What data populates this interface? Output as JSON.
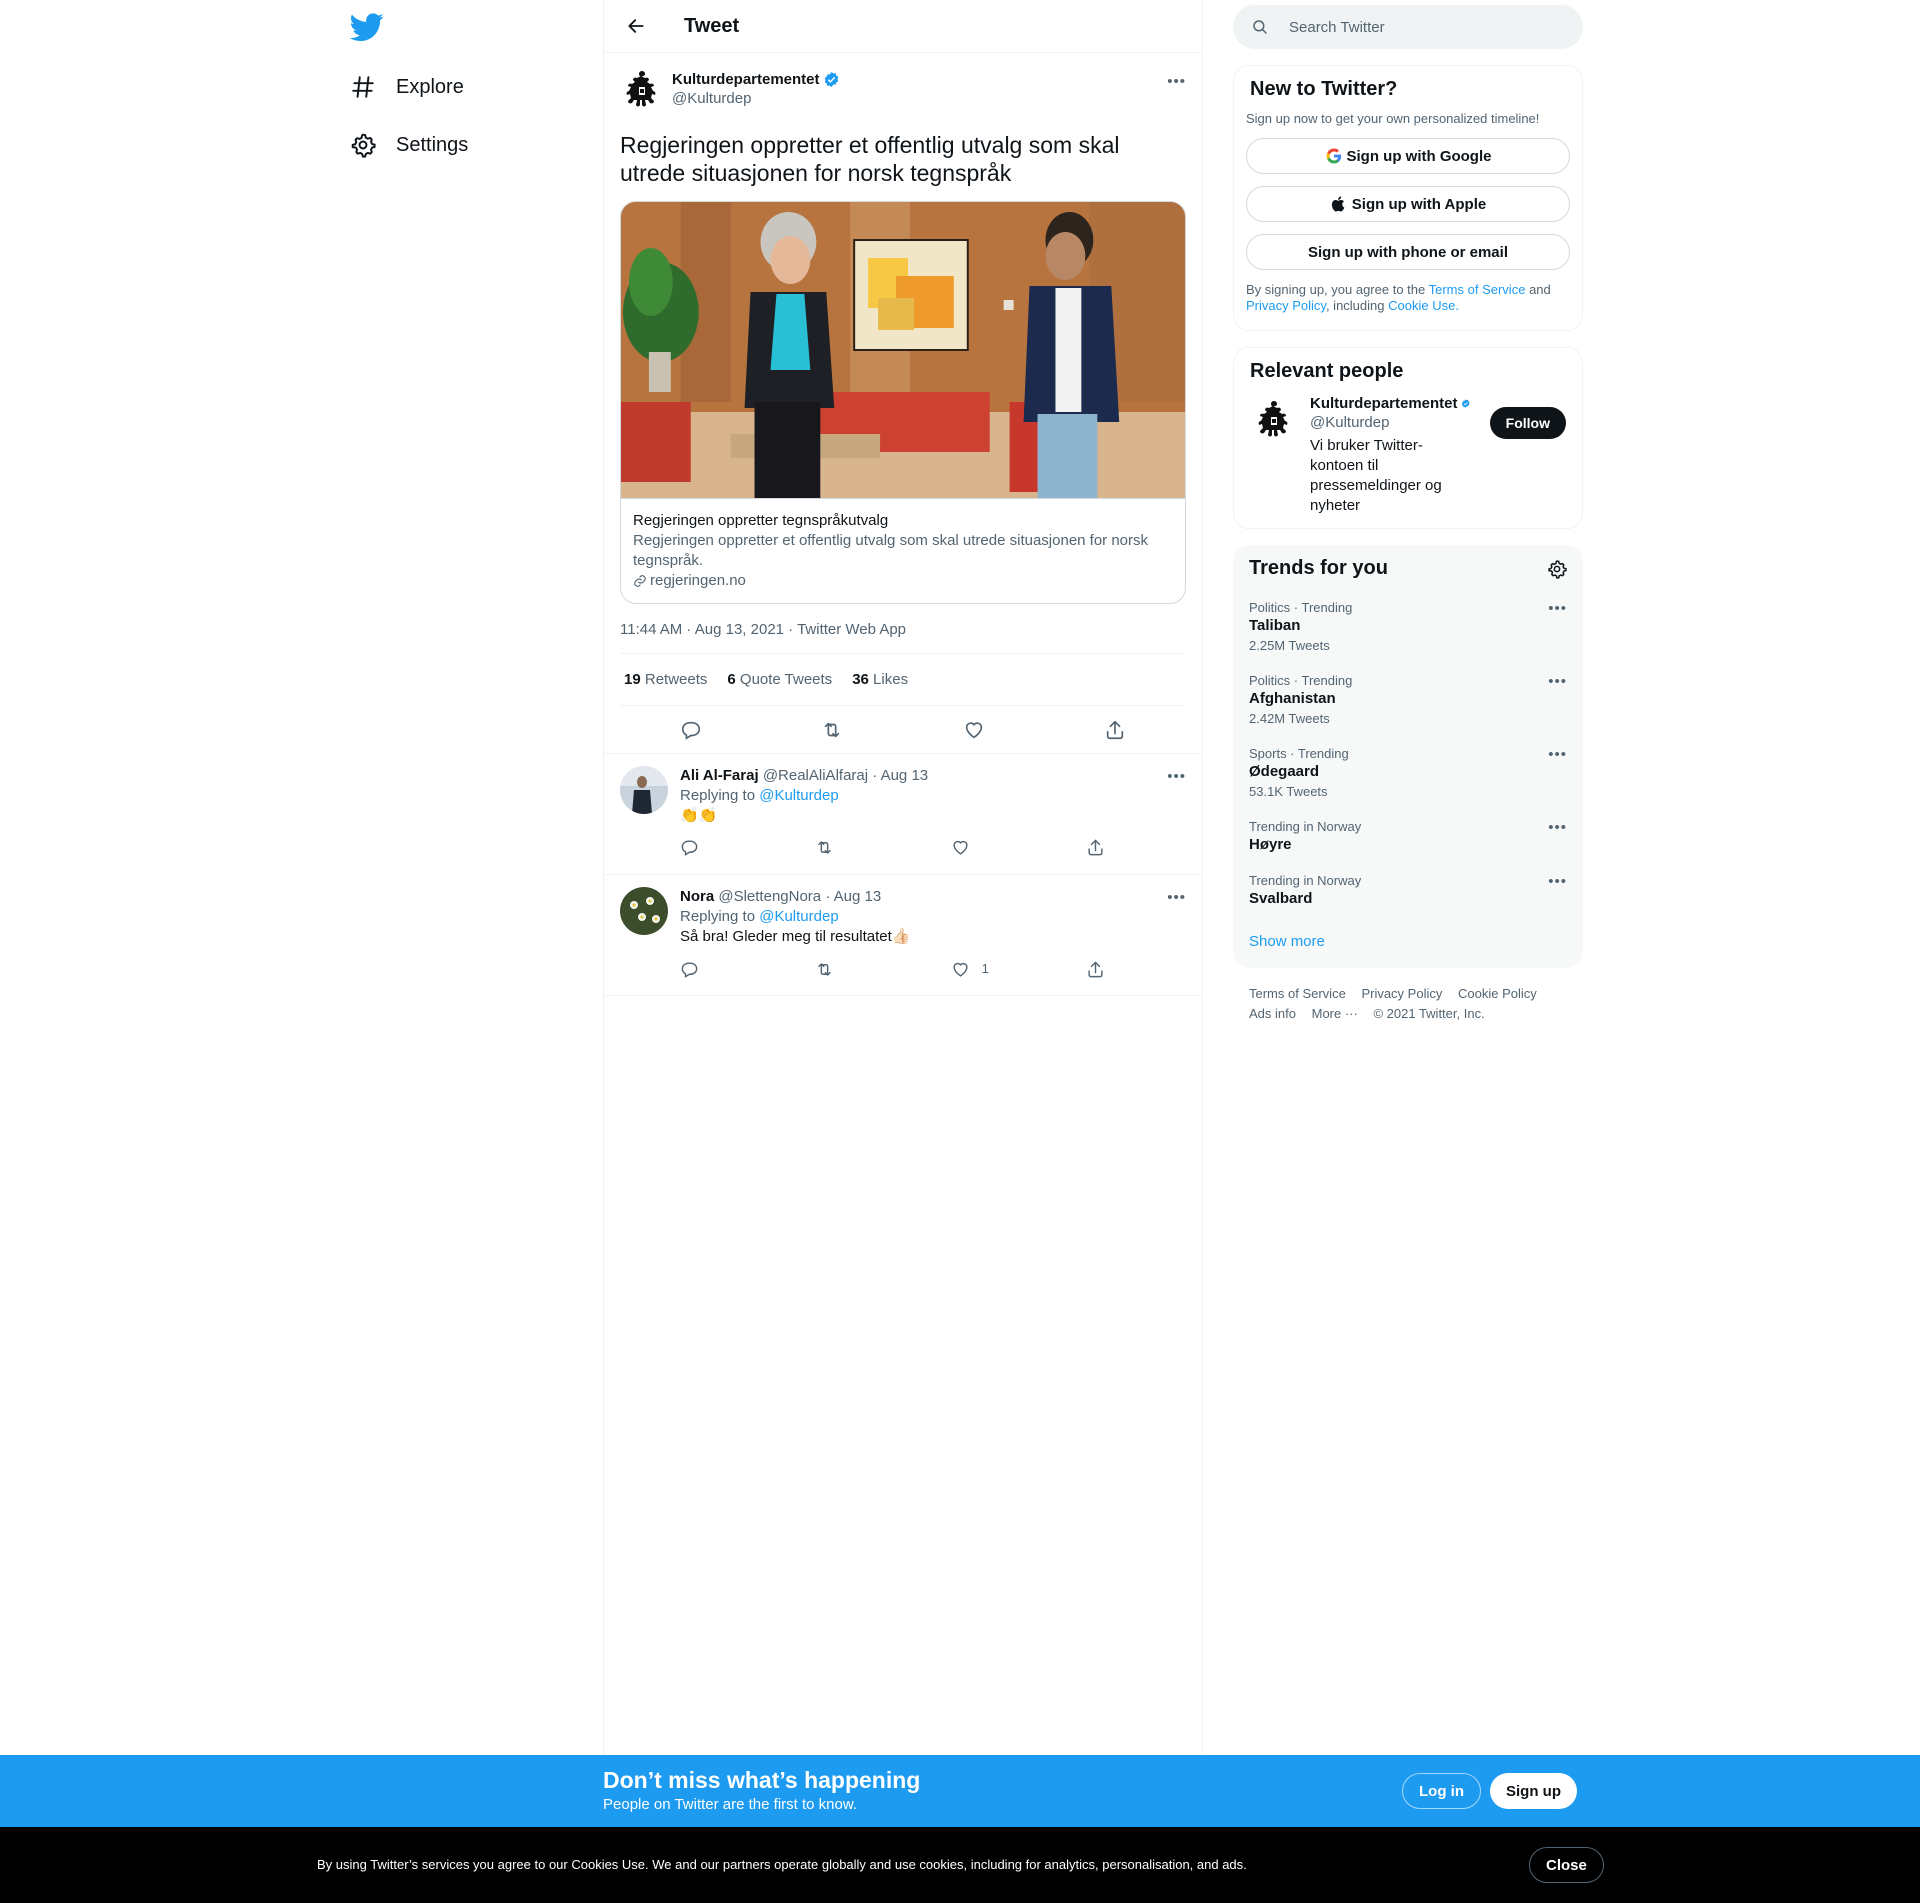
{
  "nav": {
    "logo_icon": "twitter-bird-icon",
    "items": [
      {
        "label": "Explore",
        "icon": "hashtag-icon"
      },
      {
        "label": "Settings",
        "icon": "gear-icon"
      }
    ]
  },
  "header": {
    "title": "Tweet"
  },
  "tweet": {
    "author_name": "Kulturdepartementet",
    "author_handle": "@Kulturdep",
    "text": "Regjeringen oppretter et offentlig utvalg som skal utrede situasjonen for norsk tegnspråk",
    "card": {
      "title": "Regjeringen oppretter tegnspråkutvalg",
      "description": "Regjeringen oppretter et offentlig utvalg som skal utrede situasjonen for norsk tegnspråk.",
      "domain": "regjeringen.no"
    },
    "meta": "11:44 AM · Aug 13, 2021 · Twitter Web App",
    "stats": {
      "retweets_count": "19",
      "retweets_label": "Retweets",
      "quotes_count": "6",
      "quotes_label": "Quote Tweets",
      "likes_count": "36",
      "likes_label": "Likes"
    }
  },
  "replies": [
    {
      "name": "Ali Al-Faraj",
      "handle": "@RealAliAlfaraj",
      "date": "· Aug 13",
      "replying_prefix": "Replying to",
      "replying_to": "@Kulturdep",
      "text": "👏👏",
      "like_count": ""
    },
    {
      "name": "Nora",
      "handle": "@SlettengNora",
      "date": "· Aug 13",
      "replying_prefix": "Replying to",
      "replying_to": "@Kulturdep",
      "text": "Så bra! Gleder meg til resultatet👍🏻",
      "like_count": "1"
    }
  ],
  "right": {
    "search_placeholder": "Search Twitter",
    "signup": {
      "title": "New to Twitter?",
      "subtitle": "Sign up now to get your own personalized timeline!",
      "google": "Sign up with Google",
      "apple": "Sign up with Apple",
      "phone": "Sign up with phone or email",
      "legal_1": "By signing up, you agree to the",
      "terms": "Terms of Service",
      "legal_2": "and",
      "privacy": "Privacy Policy",
      "legal_3": ", including",
      "cookie": "Cookie Use."
    },
    "relevant": {
      "title": "Relevant people",
      "name": "Kulturdepartementet",
      "handle": "@Kulturdep",
      "bio": "Vi bruker Twitter-kontoen til pressemeldinger og nyheter",
      "follow": "Follow"
    },
    "trends": {
      "title": "Trends for you",
      "items": [
        {
          "category": "Politics · Trending",
          "name": "Taliban",
          "count": "2.25M Tweets"
        },
        {
          "category": "Politics · Trending",
          "name": "Afghanistan",
          "count": "2.42M Tweets"
        },
        {
          "category": "Sports · Trending",
          "name": "Ødegaard",
          "count": "53.1K Tweets"
        },
        {
          "category": "Trending in Norway",
          "name": "Høyre",
          "count": ""
        },
        {
          "category": "Trending in Norway",
          "name": "Svalbard",
          "count": ""
        }
      ],
      "show_more": "Show more"
    },
    "footer": {
      "terms": "Terms of Service",
      "privacy": "Privacy Policy",
      "cookie": "Cookie Policy",
      "ads": "Ads info",
      "more": "More ···",
      "copyright": "© 2021 Twitter, Inc."
    }
  },
  "promo": {
    "title": "Don’t miss what’s happening",
    "subtitle": "People on Twitter are the first to know.",
    "login": "Log in",
    "signup": "Sign up"
  },
  "cookie_bar": {
    "text": "By using Twitter’s services you agree to our Cookies Use. We and our partners operate globally and use cookies, including for analytics, personalisation, and ads.",
    "close": "Close"
  },
  "colors": {
    "accent": "#1d9bf0",
    "text": "#0f1419",
    "muted": "#536471"
  }
}
